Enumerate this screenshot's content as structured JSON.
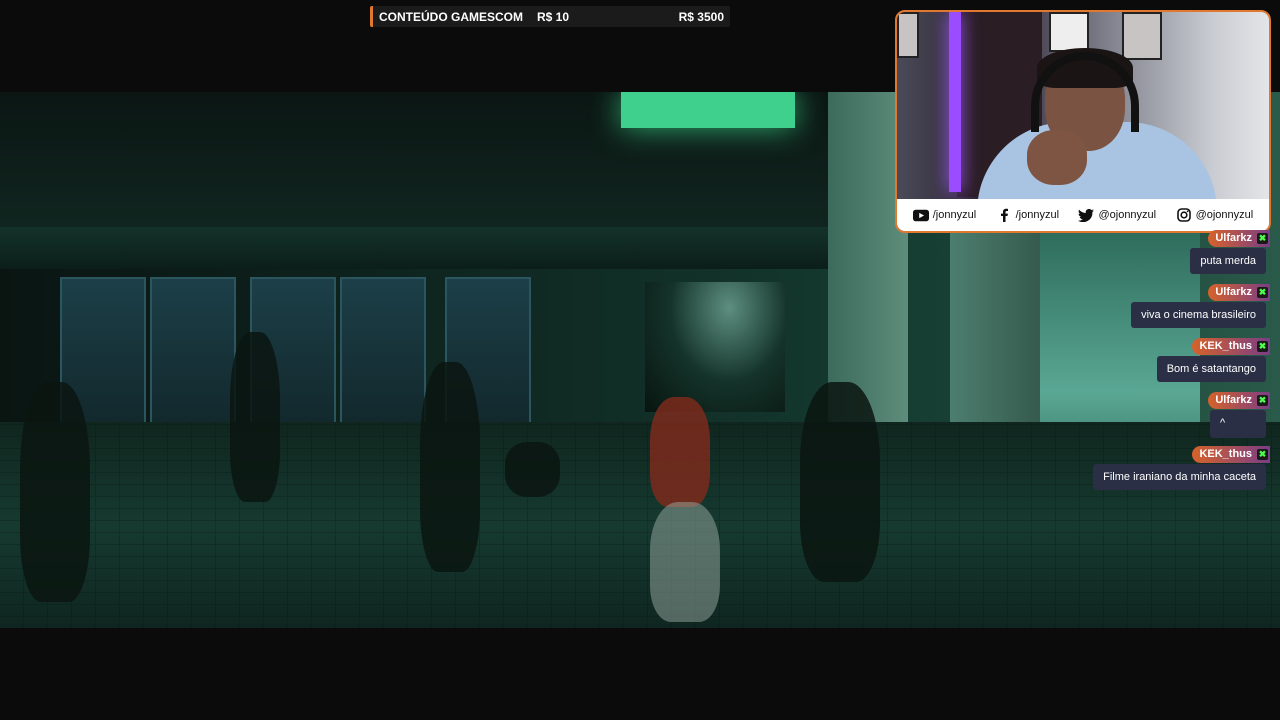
{
  "goal": {
    "title": "CONTEÚDO GAMESCOM",
    "current": "R$ 10",
    "target": "R$ 3500"
  },
  "video": {
    "kind": "movie-frame"
  },
  "webcam": {
    "socials": [
      {
        "icon": "youtube-icon",
        "handle": "/jonnyzul"
      },
      {
        "icon": "facebook-icon",
        "handle": "/jonnyzul"
      },
      {
        "icon": "twitter-icon",
        "handle": "@ojonnyzul"
      },
      {
        "icon": "instagram-icon",
        "handle": "@ojonnyzul"
      }
    ]
  },
  "chat": {
    "badge_glyph": "✖",
    "messages": [
      {
        "user": "Ulfarkz",
        "text": "puta merda"
      },
      {
        "user": "Ulfarkz",
        "text": "viva o cinema brasileiro"
      },
      {
        "user": "KEK_thus",
        "text": "Bom é satantango"
      },
      {
        "user": "Ulfarkz",
        "text": "^"
      },
      {
        "user": "KEK_thus",
        "text": "Filme iraniano da minha caceta"
      }
    ]
  },
  "colors": {
    "accent": "#e0782f",
    "chat_bubble": "#2a2f45",
    "name_gradient_start": "#d5622a",
    "name_gradient_end": "#7a3d86",
    "badge_green": "#4cff4c"
  }
}
